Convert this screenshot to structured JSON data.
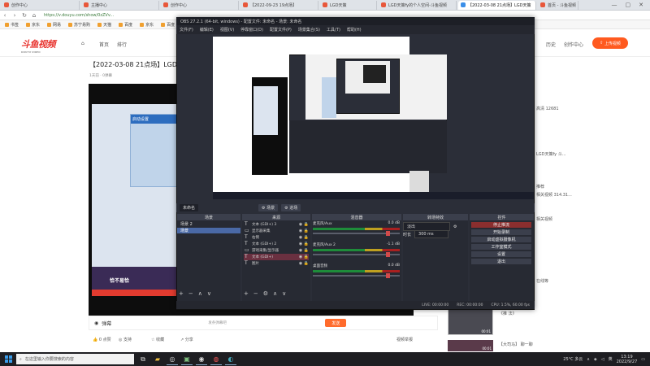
{
  "browser": {
    "tabs": [
      {
        "label": "创作中心",
        "active": false
      },
      {
        "label": "主播中心",
        "active": false
      },
      {
        "label": "创作中心",
        "active": false
      },
      {
        "label": "【2022-09-23 19点场】",
        "active": false
      },
      {
        "label": "LGD天策",
        "active": false
      },
      {
        "label": "LGD天策fy的个人空间-斗鱼视频",
        "active": false
      },
      {
        "label": "【2022-03-08 21点场】LGD天策",
        "active": true
      },
      {
        "label": "首页 - 斗鱼视频",
        "active": false
      }
    ],
    "url": "https://v.douyu.com/show/0zZVv...",
    "bookmarks": [
      "书签",
      "京东",
      "网易",
      "苏宁易购",
      "天猫",
      "百度",
      "京东",
      "百度",
      "天猫"
    ],
    "window_controls": [
      "—",
      "▢",
      "✕"
    ]
  },
  "site": {
    "logo": "斗鱼视频",
    "logo_sub": "DOUYU VIDEO",
    "nav": [
      "首页",
      "排行"
    ],
    "header_right": [
      "历史",
      "创作中心"
    ],
    "upload": "上传视频"
  },
  "video": {
    "title": "【2022-03-08 21点场】LGD天",
    "meta": "1天前 · 0弹幕",
    "overlay_title": "启动设置",
    "overlay_banner": "恰不易恰",
    "danmaku_placeholder": "发条弹幕吧",
    "send": "发送",
    "danmaku_label": "弹幕",
    "actions": [
      "0 点赞",
      "支持",
      "收藏",
      "分享"
    ],
    "report": "视频举报"
  },
  "right_column": {
    "texts": [
      "高清 12681",
      "LGD天策fy 斗...",
      "推荐",
      "相关视频 314.31...",
      "相关视频",
      "在线等",
      "《推 法》",
      "【大司马】 聊一聊"
    ],
    "thumb_time": "00:01",
    "thumb_time2": "00:01"
  },
  "obs": {
    "title": "OBS 27.2.1 (64-bit, windows) - 配置文件: 未命名 - 场景: 未命名",
    "menu": [
      "文件(F)",
      "编辑(E)",
      "视图(V)",
      "停靠窗口(D)",
      "配置文件(P)",
      "场景集合(S)",
      "工具(T)",
      "帮助(H)"
    ],
    "preview_tabs": [
      "未命名",
      "场景",
      "进场"
    ],
    "scenes_header": "场景",
    "scenes": [
      "场景 2",
      "场景"
    ],
    "sources_header": "来源",
    "sources": [
      {
        "icon": "T",
        "label": "文本 (GDI+) 3"
      },
      {
        "icon": "▭",
        "label": "显示器采集"
      },
      {
        "icon": "T",
        "label": "右侧"
      },
      {
        "icon": "T",
        "label": "文本 (GDI+) 2"
      },
      {
        "icon": "▭",
        "label": "游戏采集/显示器"
      },
      {
        "icon": "T",
        "label": "文本 (GDI+)",
        "selected": true
      },
      {
        "icon": "T",
        "label": "图片"
      }
    ],
    "mixer_header": "混音器",
    "mixer": [
      {
        "name": "麦克风/Aux",
        "db": "0.0 dB"
      },
      {
        "name": "麦克风/Aux 2",
        "db": "-1.1 dB"
      },
      {
        "name": "桌面音频",
        "db": "0.0 dB"
      }
    ],
    "transitions_header": "转场特效",
    "transition_label": "淡出",
    "duration_label": "时长",
    "duration_value": "300 ms",
    "controls_header": "控件",
    "controls": [
      {
        "label": "停止推流",
        "on": true
      },
      {
        "label": "开始录制",
        "on": false
      },
      {
        "label": "启动虚拟摄像机",
        "on": false
      },
      {
        "label": "工作室模式",
        "on": false
      },
      {
        "label": "设置",
        "on": false
      },
      {
        "label": "退出",
        "on": false
      }
    ],
    "status": [
      "LIVE: 00:00:00",
      "REC: 00:00:00",
      "CPU: 1.5%, 60.00 fps"
    ]
  },
  "taskbar": {
    "search_placeholder": "在这里输入你要搜索的内容",
    "weather": "25°C 多云",
    "lang": "英",
    "time": "13:19",
    "date": "2022/9/27"
  }
}
